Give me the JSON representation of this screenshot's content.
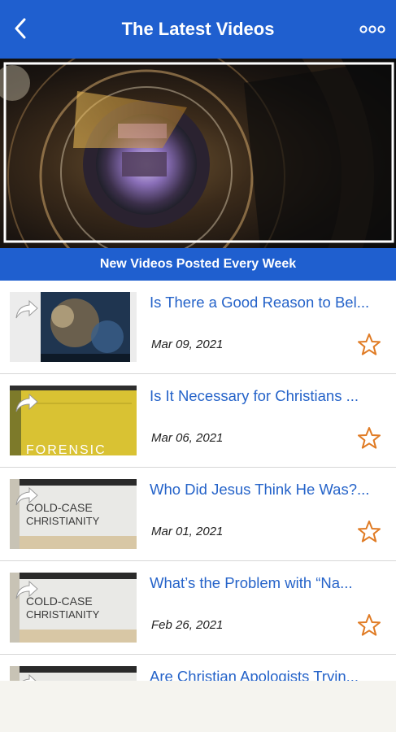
{
  "header": {
    "title": "The Latest Videos",
    "back_icon": "chevron-left-icon",
    "more_icon": "more-horizontal-icon"
  },
  "hero": {
    "image": "camera-lens-photo"
  },
  "banner": {
    "text": "New Videos Posted Every Week"
  },
  "videos": [
    {
      "title": "Is There a Good Reason to Bel...",
      "date": "Mar 09, 2021",
      "thumb": "space-nebula-book"
    },
    {
      "title": "Is It Necessary for Christians ...",
      "date": "Mar 06, 2021",
      "thumb": "forensic-book"
    },
    {
      "title": "Who Did Jesus Think He Was?...",
      "date": "Mar 01, 2021",
      "thumb": "cold-case-christianity-book"
    },
    {
      "title": "What’s the Problem with “Na...",
      "date": "Feb 26, 2021",
      "thumb": "cold-case-christianity-book"
    },
    {
      "title": "Are Christian Apologists Tryin...",
      "date": "",
      "thumb": "cold-case-christianity-book"
    }
  ],
  "colors": {
    "brand_blue": "#1f5fcf",
    "link_blue": "#2563c9",
    "star_orange": "#e07b24"
  }
}
